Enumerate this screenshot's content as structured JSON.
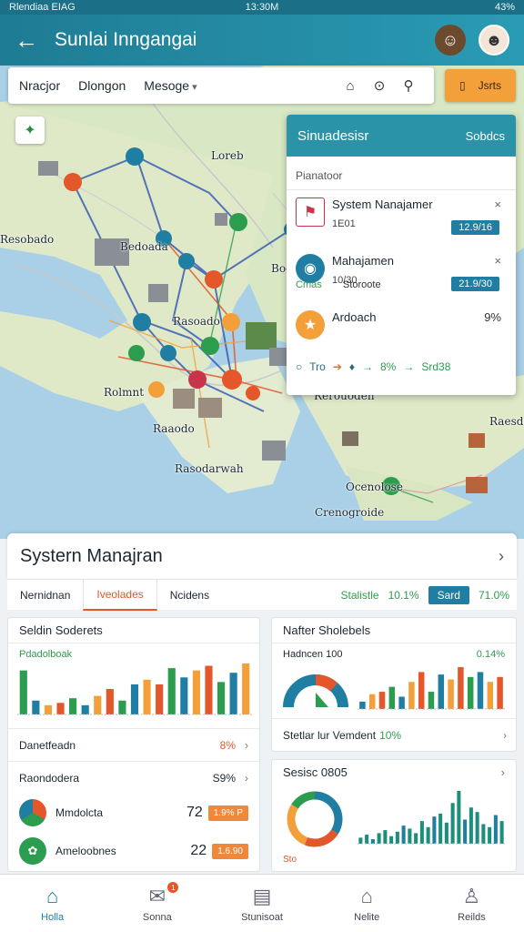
{
  "status": {
    "left": "Rlendiaa EIAG",
    "center": "13:30M",
    "right": "43%"
  },
  "header": {
    "title": "Sunlai Inngangai"
  },
  "toolbar": {
    "item1": "Nracjor",
    "item2": "Dlongon",
    "item3": "Mesoge",
    "button_label": "Jsrts"
  },
  "map_labels": [
    "Loreb",
    "Bedoada",
    "Rasoado",
    "Resobado",
    "Bootr",
    "Rolmnt",
    "Rerouoden",
    "Rasodarwah",
    "Raaodo",
    "Raesdooh",
    "Ocenolose",
    "Crenogroide"
  ],
  "panel": {
    "title": "Sinuadesisr",
    "subtitle": "Sobdcs",
    "label": "Pianatoor",
    "items": [
      {
        "name": "System Nanajamer",
        "number": "1E01",
        "tag": "12.9/16"
      },
      {
        "name": "Mahajamen",
        "number": "10/30",
        "tag": "21.9/30",
        "green": "Cmas",
        "green2": "Storoote"
      },
      {
        "name": "Ardoach",
        "pct": "9%"
      }
    ],
    "icons_row": {
      "t1": "Tro",
      "t2": "8%",
      "t3": "Srd38"
    }
  },
  "sheet": {
    "title": "Systern Manajran",
    "tabs": [
      "Nernidnan",
      "Iveolades",
      "Ncidens"
    ],
    "stat_label": "Stalistle",
    "stat_pct": "10.1%",
    "badge": "Sard",
    "pct2": "71.0%"
  },
  "card1": {
    "title": "Seldin Soderets",
    "sub_label": "Pdadolboak",
    "row1": {
      "label": "Danetfeadn",
      "value": "8%"
    },
    "row2": {
      "label": "Raondodera",
      "value": "S9%"
    },
    "list": [
      {
        "label": "Mmdolcta",
        "value": "72",
        "tag": "1.9% P"
      },
      {
        "label": "Ameloobnes",
        "value": "22",
        "tag": "1.6.90"
      }
    ]
  },
  "card2": {
    "title": "Nafter Sholebels",
    "sub_label": "Hadncen 100",
    "sub_pct": "0.14%",
    "row1": {
      "label": "Stetlar lur Vemdent",
      "value": "10%"
    },
    "title2": "Sesisc 0805",
    "gauge_caption": "Sto"
  },
  "chart_data": [
    {
      "type": "bar",
      "values": [
        38,
        12,
        8,
        10,
        14,
        8,
        16,
        22,
        12,
        26,
        30,
        26,
        40,
        32,
        38,
        42,
        28,
        36,
        44
      ]
    },
    {
      "type": "bar",
      "values": [
        6,
        12,
        14,
        18,
        10,
        22,
        30,
        14,
        28,
        24,
        34,
        26,
        30,
        22,
        26
      ]
    },
    {
      "type": "pie",
      "values": [
        34,
        22,
        28,
        16
      ],
      "colors": [
        "#1f7ea1",
        "#e3572b",
        "#f3a03a",
        "#2c9d4e"
      ]
    },
    {
      "type": "bar",
      "values": [
        8,
        12,
        6,
        14,
        18,
        10,
        16,
        24,
        20,
        14,
        30,
        22,
        36,
        40,
        28,
        54,
        70,
        32,
        48,
        42,
        26,
        22,
        38,
        30
      ]
    }
  ],
  "colors": {
    "primary": "#1f7ea1",
    "accent": "#e3572b",
    "green": "#2c9d4e",
    "orange": "#f3a03a"
  },
  "nav": [
    {
      "label": "Holla",
      "icon": "home-icon"
    },
    {
      "label": "Sonna",
      "icon": "inbox-icon"
    },
    {
      "label": "Stunisoat",
      "icon": "document-icon"
    },
    {
      "label": "Nelite",
      "icon": "building-icon"
    },
    {
      "label": "Reilds",
      "icon": "user-icon"
    }
  ]
}
